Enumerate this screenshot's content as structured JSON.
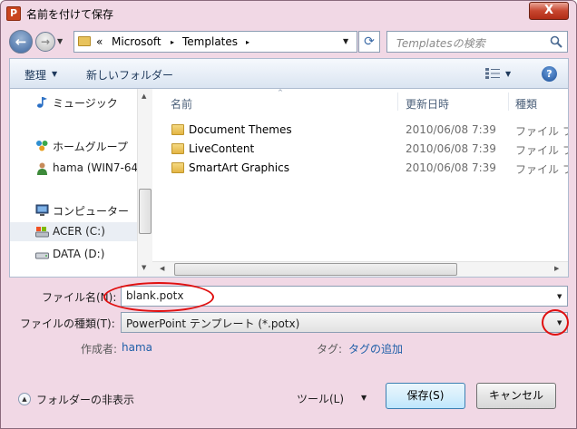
{
  "window": {
    "title": "名前を付けて保存",
    "close_glyph": "X"
  },
  "nav": {
    "back_glyph": "←",
    "forward_glyph": "→",
    "history_glyph": "▼",
    "address": {
      "overflow": "«",
      "crumbs": [
        "Microsoft",
        "Templates"
      ],
      "separator": "▸",
      "dropdown_glyph": "▼"
    },
    "refresh_glyph": "⟳",
    "search_placeholder": "Templatesの検索"
  },
  "toolbar": {
    "organize": "整理",
    "new_folder": "新しいフォルダー",
    "dropdown_glyph": "▼",
    "help_glyph": "?"
  },
  "sidebar": {
    "items": [
      {
        "label": "ミュージック",
        "icon": "music-icon"
      },
      {
        "label": "ホームグループ",
        "icon": "homegroup-icon"
      },
      {
        "label": "hama (WIN7-64",
        "icon": "user-icon"
      },
      {
        "label": "コンピューター",
        "icon": "computer-icon"
      },
      {
        "label": "ACER (C:)",
        "icon": "drive-icon"
      },
      {
        "label": "DATA (D:)",
        "icon": "drive-icon"
      }
    ],
    "scroll_up": "▲",
    "scroll_down": "▼",
    "grip": "≡"
  },
  "file_list": {
    "columns": {
      "name": "名前",
      "date": "更新日時",
      "type": "種類"
    },
    "sort_glyph": "^",
    "rows": [
      {
        "name": "Document Themes",
        "date": "2010/06/08 7:39",
        "type": "ファイル フ"
      },
      {
        "name": "LiveContent",
        "date": "2010/06/08 7:39",
        "type": "ファイル フ"
      },
      {
        "name": "SmartArt Graphics",
        "date": "2010/06/08 7:39",
        "type": "ファイル フ"
      }
    ],
    "scroll_left": "◀",
    "scroll_right": "▶",
    "grip": "|||"
  },
  "form": {
    "filename_label": "ファイル名(N):",
    "filename_value": "blank.potx",
    "filetype_label": "ファイルの種類(T):",
    "filetype_value": "PowerPoint テンプレート (*.potx)",
    "dropdown_glyph": "▼",
    "author_label": "作成者:",
    "author_value": "hama",
    "tag_label": "タグ:",
    "tag_value": "タグの追加"
  },
  "footer": {
    "hide_folders": "フォルダーの非表示",
    "hide_folders_glyph": "▲",
    "tools": "ツール(L)",
    "tools_arrow": "▼",
    "save": "保存(S)",
    "cancel": "キャンセル"
  },
  "colors": {
    "title_bar": "#f1d8e5",
    "annotation": "#e01010",
    "link": "#1f5fa8"
  }
}
